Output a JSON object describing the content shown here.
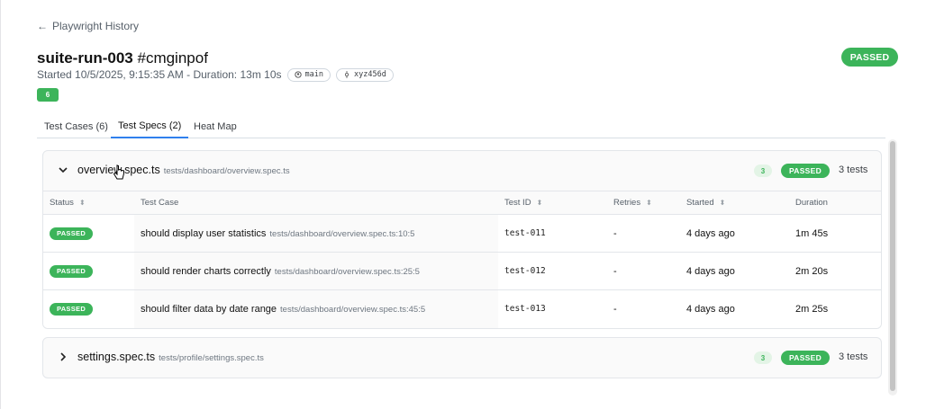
{
  "back": {
    "label": "Playwright History"
  },
  "run": {
    "name": "suite-run-003",
    "hash": "#cmginpof",
    "started": "Started 10/5/2025, 9:15:35 AM - Duration: 13m 10s",
    "branch": "main",
    "commit": "xyz456d",
    "count": "6",
    "status": "PASSED"
  },
  "tabs": [
    {
      "label": "Test Cases (6)"
    },
    {
      "label": "Test Specs (2)"
    },
    {
      "label": "Heat Map"
    }
  ],
  "columns": [
    "Status",
    "Test Case",
    "Test ID",
    "Retries",
    "Started",
    "Duration"
  ],
  "specs": [
    {
      "name": "overview.spec.ts",
      "path": "tests/dashboard/overview.spec.ts",
      "count": "3",
      "status": "PASSED",
      "tests": "3 tests",
      "rows": [
        {
          "status": "PASSED",
          "name": "should display user statistics",
          "path": "tests/dashboard/overview.spec.ts:10:5",
          "id": "test-011",
          "retries": "-",
          "started": "4 days ago",
          "duration": "1m 45s"
        },
        {
          "status": "PASSED",
          "name": "should render charts correctly",
          "path": "tests/dashboard/overview.spec.ts:25:5",
          "id": "test-012",
          "retries": "-",
          "started": "4 days ago",
          "duration": "2m 20s"
        },
        {
          "status": "PASSED",
          "name": "should filter data by date range",
          "path": "tests/dashboard/overview.spec.ts:45:5",
          "id": "test-013",
          "retries": "-",
          "started": "4 days ago",
          "duration": "2m 25s"
        }
      ]
    },
    {
      "name": "settings.spec.ts",
      "path": "tests/profile/settings.spec.ts",
      "count": "3",
      "status": "PASSED",
      "tests": "3 tests"
    }
  ],
  "colors": {
    "passed": "#3cb45a",
    "tab_active": "#2f80ed"
  },
  "icons": [
    "arrow-left-icon",
    "github-icon",
    "commit-icon",
    "chevron-down-icon",
    "chevron-right-icon",
    "sort-icon",
    "pointer-cursor-icon"
  ]
}
